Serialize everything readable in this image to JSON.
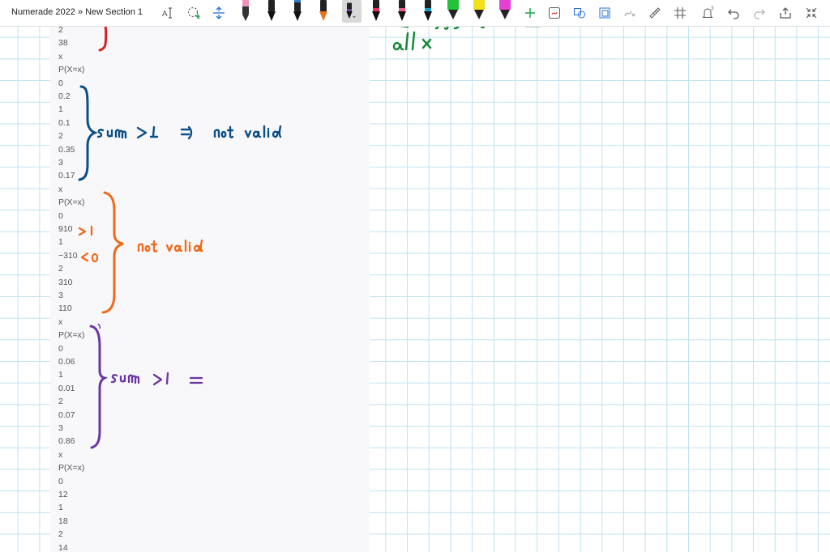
{
  "breadcrumb": "Numerade 2022 » New Section 1",
  "lines": [
    "2",
    "38",
    "x",
    "P(X=x)",
    "0",
    "0.2",
    "1",
    "0.1",
    "2",
    "0.35",
    "3",
    "0.17",
    "x",
    "P(X=x)",
    "0",
    "910",
    "1",
    "−310",
    "2",
    "310",
    "3",
    "110",
    "x",
    "P(X=x)",
    "0",
    "0.06",
    "1",
    "0.01",
    "2",
    "0.07",
    "3",
    "0.86",
    "x",
    "P(X=x)",
    "0",
    "12",
    "1",
    "18",
    "2",
    "14"
  ],
  "toolbar": {
    "pens": [
      {
        "name": "pen-pink",
        "color": "#f090b8"
      },
      {
        "name": "pen-black",
        "color": "#111111"
      },
      {
        "name": "pen-black-2",
        "color": "#111111"
      },
      {
        "name": "pen-blue",
        "color": "#1f6ea8"
      },
      {
        "name": "pen-orange",
        "color": "#e8731f"
      },
      {
        "name": "pen-purple-selected",
        "color": "#6a3ea1"
      },
      {
        "name": "pen-red",
        "color": "#e0305a"
      },
      {
        "name": "pen-pink-2",
        "color": "#e0305a"
      },
      {
        "name": "highlighter-green",
        "color": "#22c23a"
      },
      {
        "name": "highlighter-yellow",
        "color": "#f2e21a"
      },
      {
        "name": "highlighter-magenta",
        "color": "#e53fd3"
      }
    ],
    "notification_count": "3"
  },
  "ink_colors": {
    "red": "#d42424",
    "blue": "#0b4f86",
    "orange": "#ef6a1a",
    "purple": "#6b36a3",
    "green": "#168a3a"
  }
}
